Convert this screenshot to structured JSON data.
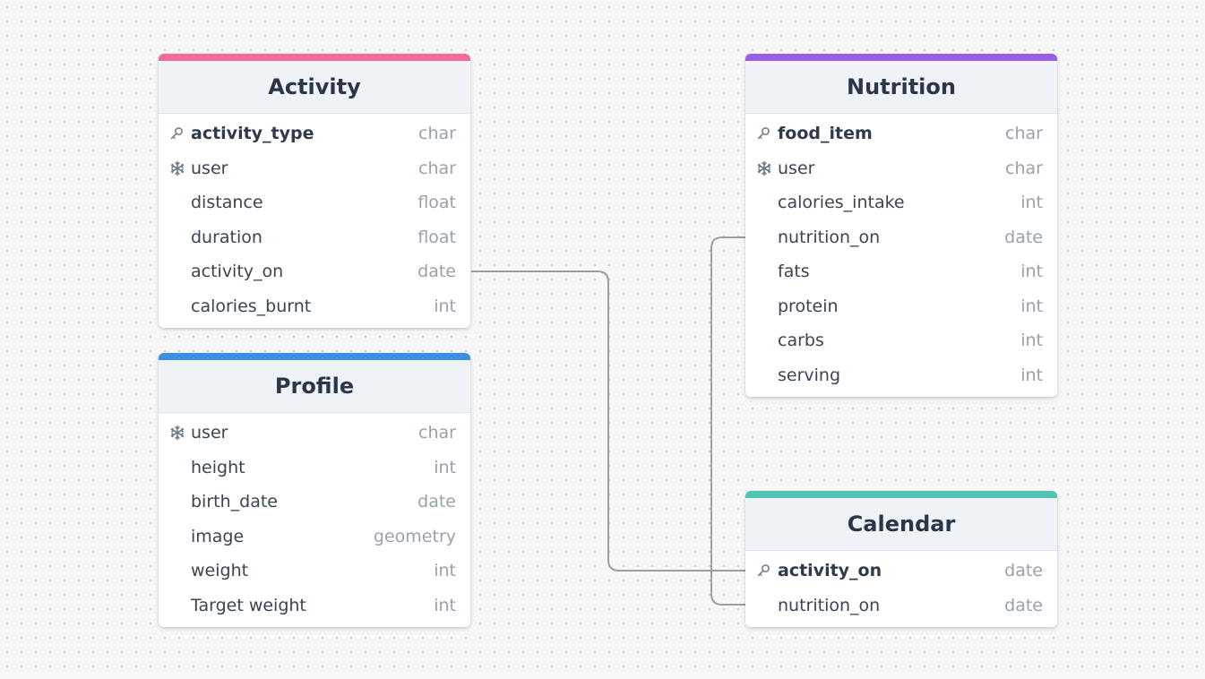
{
  "tables": {
    "activity": {
      "title": "Activity",
      "accent": "#ef6b99",
      "fields": [
        {
          "name": "activity_type",
          "type": "char",
          "icon": "key-icon"
        },
        {
          "name": "user",
          "type": "char",
          "icon": "snowflake-icon"
        },
        {
          "name": "distance",
          "type": "float",
          "icon": ""
        },
        {
          "name": "duration",
          "type": "float",
          "icon": ""
        },
        {
          "name": "activity_on",
          "type": "date",
          "icon": ""
        },
        {
          "name": "calories_burnt",
          "type": "int",
          "icon": ""
        }
      ]
    },
    "profile": {
      "title": "Profile",
      "accent": "#3c8fde",
      "fields": [
        {
          "name": "user",
          "type": "char",
          "icon": "snowflake-icon"
        },
        {
          "name": "height",
          "type": "int",
          "icon": ""
        },
        {
          "name": "birth_date",
          "type": "date",
          "icon": ""
        },
        {
          "name": "image",
          "type": "geometry",
          "icon": ""
        },
        {
          "name": "weight",
          "type": "int",
          "icon": ""
        },
        {
          "name": "Target weight",
          "type": "int",
          "icon": ""
        }
      ]
    },
    "nutrition": {
      "title": "Nutrition",
      "accent": "#9a5fe0",
      "fields": [
        {
          "name": "food_item",
          "type": "char",
          "icon": "key-icon"
        },
        {
          "name": "user",
          "type": "char",
          "icon": "snowflake-icon"
        },
        {
          "name": "calories_intake",
          "type": "int",
          "icon": ""
        },
        {
          "name": "nutrition_on",
          "type": "date",
          "icon": ""
        },
        {
          "name": "fats",
          "type": "int",
          "icon": ""
        },
        {
          "name": "protein",
          "type": "int",
          "icon": ""
        },
        {
          "name": "carbs",
          "type": "int",
          "icon": ""
        },
        {
          "name": "serving",
          "type": "int",
          "icon": ""
        }
      ]
    },
    "calendar": {
      "title": "Calendar",
      "accent": "#4fc4b5",
      "fields": [
        {
          "name": "activity_on",
          "type": "date",
          "icon": "key-icon"
        },
        {
          "name": "nutrition_on",
          "type": "date",
          "icon": ""
        }
      ]
    }
  },
  "relations": [
    {
      "from": "Activity.activity_on",
      "to": "Calendar.activity_on"
    },
    {
      "from": "Nutrition.nutrition_on",
      "to": "Calendar.nutrition_on"
    }
  ],
  "colors": {
    "connector": "#9e9e9e",
    "header_bg": "#eff3f8"
  }
}
